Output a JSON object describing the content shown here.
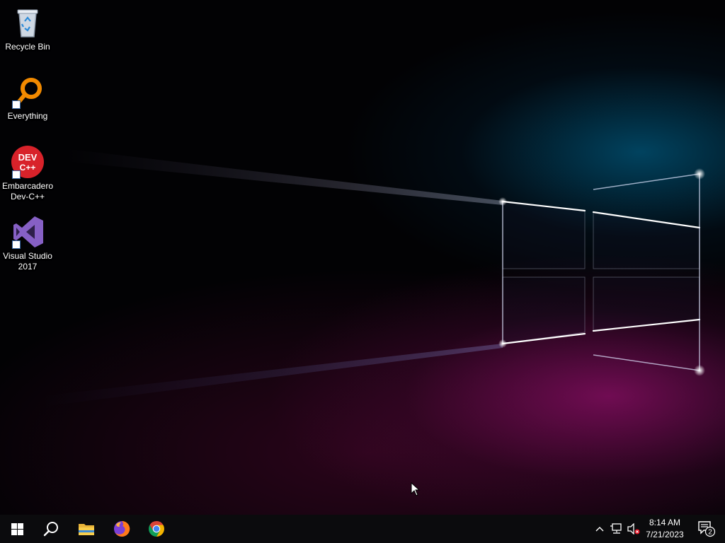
{
  "desktop": {
    "icons": [
      {
        "label_line1": "Recycle Bin",
        "label_line2": "",
        "icon": "recycle-bin-icon"
      },
      {
        "label_line1": "Everything",
        "label_line2": "",
        "icon": "everything-search-icon"
      },
      {
        "label_line1": "Embarcadero",
        "label_line2": "Dev-C++",
        "icon": "dev-cpp-icon",
        "icon_text_top": "DEV",
        "icon_text_bottom": "C++"
      },
      {
        "label_line1": "Visual Studio",
        "label_line2": "2017",
        "icon": "visual-studio-icon"
      }
    ]
  },
  "taskbar": {
    "start_icon": "windows-logo-icon",
    "pinned": [
      {
        "name": "search-icon"
      },
      {
        "name": "file-explorer-icon"
      },
      {
        "name": "firefox-icon"
      },
      {
        "name": "chrome-icon"
      }
    ],
    "tray": {
      "icons": [
        "chevron-up-icon",
        "network-icon",
        "volume-muted-icon"
      ],
      "time": "8:14 AM",
      "date": "7/21/2023",
      "notification_count": "2"
    }
  },
  "colors": {
    "taskbar_bg": "#0b0b0d",
    "accent_blue": "#1fa3d6",
    "accent_pink": "#d61a9a",
    "vs_purple": "#8660c5",
    "everything_orange": "#f28a00",
    "devcpp_red": "#d8222a"
  }
}
